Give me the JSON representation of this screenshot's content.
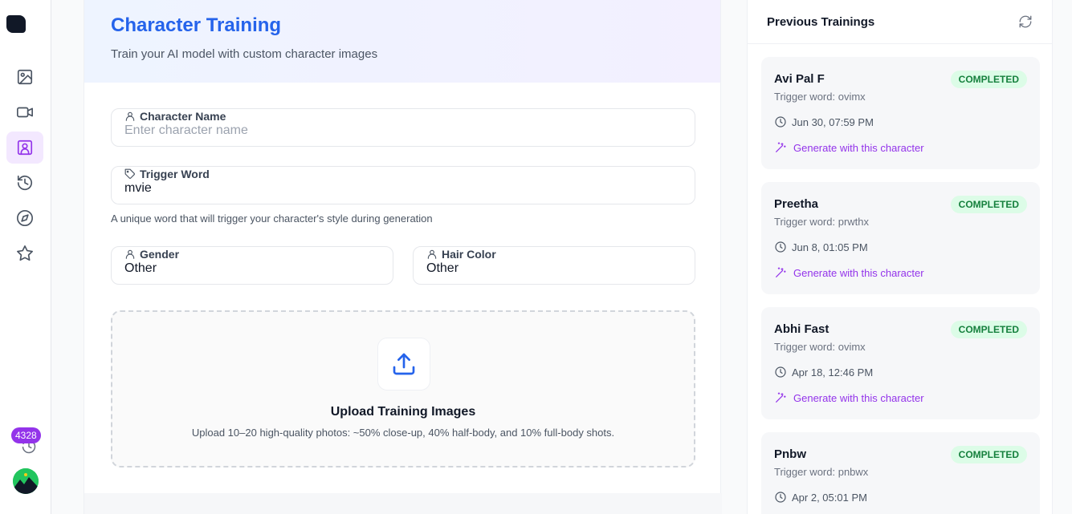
{
  "sidebar": {
    "nav": [
      {
        "icon": "image-icon"
      },
      {
        "icon": "video-icon"
      },
      {
        "icon": "character-icon",
        "active": true
      },
      {
        "icon": "history-icon"
      },
      {
        "icon": "compass-icon"
      },
      {
        "icon": "star-icon"
      }
    ],
    "credits": "4328"
  },
  "header": {
    "title": "Character Training",
    "subtitle": "Train your AI model with custom character images"
  },
  "form": {
    "character_name": {
      "label": "Character Name",
      "placeholder": "Enter character name",
      "value": ""
    },
    "trigger_word": {
      "label": "Trigger Word",
      "value": "mvie",
      "hint": "A unique word that will trigger your character's style during generation"
    },
    "gender": {
      "label": "Gender",
      "value": "Other"
    },
    "hair_color": {
      "label": "Hair Color",
      "value": "Other"
    }
  },
  "upload": {
    "title": "Upload Training Images",
    "description": "Upload 10–20 high-quality photos: ~50% close-up, 40% half-body, and 10% full-body shots."
  },
  "previous": {
    "title": "Previous Trainings",
    "items": [
      {
        "name": "Avi Pal F",
        "status": "COMPLETED",
        "trigger": "Trigger word: ovimx",
        "date": "Jun 30, 07:59 PM",
        "action": "Generate with this character"
      },
      {
        "name": "Preetha",
        "status": "COMPLETED",
        "trigger": "Trigger word: prwthx",
        "date": "Jun 8, 01:05 PM",
        "action": "Generate with this character"
      },
      {
        "name": "Abhi Fast",
        "status": "COMPLETED",
        "trigger": "Trigger word: ovimx",
        "date": "Apr 18, 12:46 PM",
        "action": "Generate with this character"
      },
      {
        "name": "Pnbw",
        "status": "COMPLETED",
        "trigger": "Trigger word: pnbwx",
        "date": "Apr 2, 05:01 PM",
        "action": ""
      }
    ]
  },
  "colors": {
    "accent": "#2563eb",
    "brand": "#9333ea",
    "success_bg": "#dcfce7",
    "success_text": "#15803d"
  }
}
